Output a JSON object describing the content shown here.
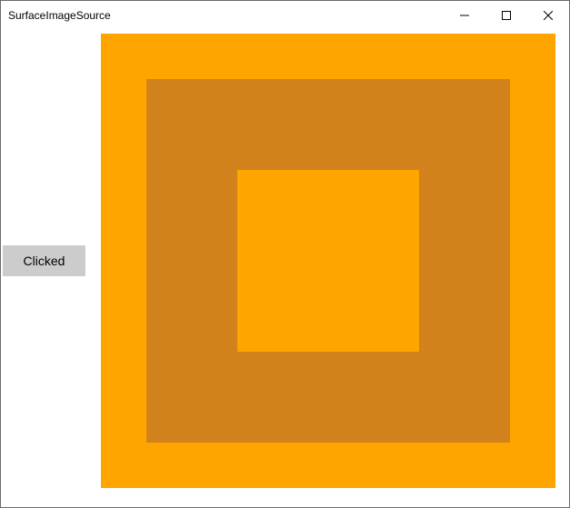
{
  "window": {
    "title": "SurfaceImageSource",
    "controls": {
      "minimize": "minimize-icon",
      "maximize": "maximize-icon",
      "close": "close-icon"
    }
  },
  "content": {
    "button_label": "Clicked",
    "canvas": {
      "outer_color": "#ffa500",
      "middle_color": "#d2821c",
      "inner_color": "#ffa500"
    }
  }
}
